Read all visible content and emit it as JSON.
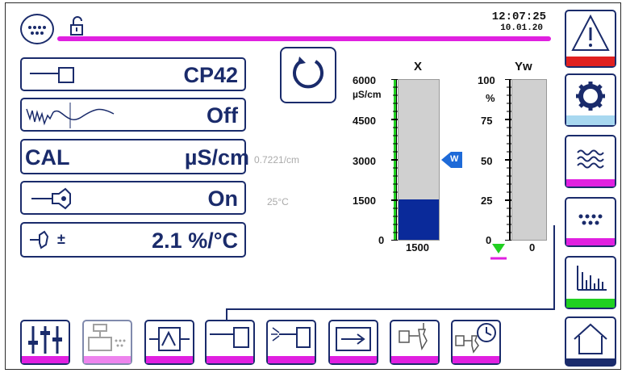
{
  "header": {
    "time": "12:07:25",
    "date": "10.01.20"
  },
  "params": {
    "sensor_label": "CP42",
    "filter_label": "Off",
    "cal_label": "CAL",
    "cal_unit": "µS/cm",
    "cal_note": "0.7221/cm",
    "temp_label": "On",
    "temp_note": "25°C",
    "comp_label": "2.1 %/°C",
    "comp_sign": "±"
  },
  "gauge_x": {
    "title": "X",
    "unit": "µS/cm",
    "ticks": [
      "6000",
      "4500",
      "3000",
      "1500",
      "0"
    ],
    "value": "1500",
    "fill_fraction": 0.25,
    "setpoint_label": "W",
    "setpoint_fraction": 0.5
  },
  "gauge_y": {
    "title": "Yw",
    "unit": "%",
    "ticks": [
      "100",
      "75",
      "50",
      "25",
      "0"
    ],
    "value": "0",
    "fill_fraction": 0.0
  },
  "colors": {
    "navy": "#1a2b6b",
    "magenta": "#e020e0",
    "alarm": "#e02020",
    "settings": "#a8d8f0",
    "green": "#20d020",
    "fill": "#0a2a9a",
    "track": "#d0d0d0"
  },
  "icons": {
    "bottom": [
      "sliders-icon",
      "valve-dots-icon",
      "controller-icon",
      "sensor-icon",
      "sensor-spark-icon",
      "output-arrow-icon",
      "valve-icon",
      "valve-timer-icon"
    ],
    "side": [
      "alarm-icon",
      "gear-icon",
      "waves-icon",
      "dots-icon",
      "bar-chart-icon",
      "home-icon"
    ]
  }
}
